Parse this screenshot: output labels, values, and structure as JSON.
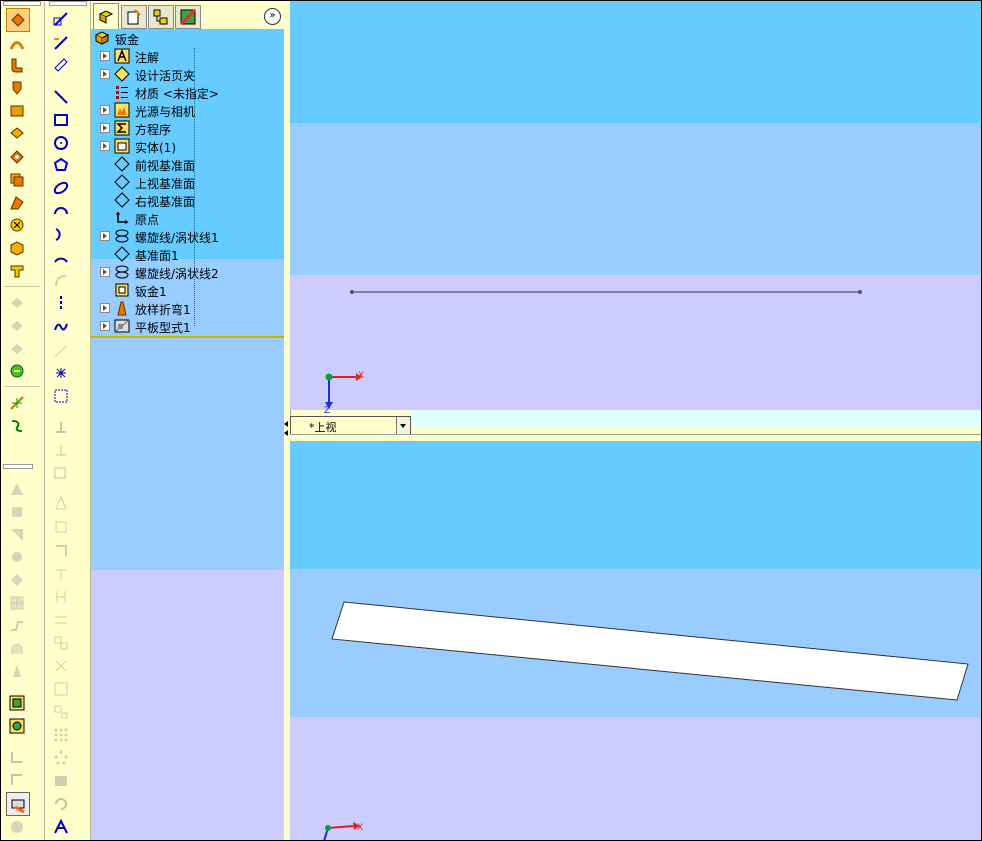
{
  "feature_tree": {
    "root": "钣金",
    "items": [
      {
        "label": "注解",
        "icon": "annotation-icon",
        "expandable": true
      },
      {
        "label": "设计活页夹",
        "icon": "design-binder-icon",
        "expandable": true
      },
      {
        "label": "材质 <未指定>",
        "icon": "material-icon",
        "expandable": false
      },
      {
        "label": "光源与相机",
        "icon": "lights-cameras-icon",
        "expandable": true
      },
      {
        "label": "方程序",
        "icon": "equations-icon",
        "expandable": true
      },
      {
        "label": "实体(1)",
        "icon": "solid-bodies-icon",
        "expandable": true
      },
      {
        "label": "前视基准面",
        "icon": "plane-icon",
        "expandable": false
      },
      {
        "label": "上视基准面",
        "icon": "plane-icon",
        "expandable": false
      },
      {
        "label": "右视基准面",
        "icon": "plane-icon",
        "expandable": false
      },
      {
        "label": "原点",
        "icon": "origin-icon",
        "expandable": false
      },
      {
        "label": "螺旋线/涡状线1",
        "icon": "helix-icon",
        "expandable": true
      },
      {
        "label": "基准面1",
        "icon": "plane-icon",
        "expandable": false
      },
      {
        "label": "螺旋线/涡状线2",
        "icon": "helix-icon",
        "expandable": true
      },
      {
        "label": "钣金1",
        "icon": "sheet-metal-feature-icon",
        "expandable": false
      },
      {
        "label": "放样折弯1",
        "icon": "lofted-bend-icon",
        "expandable": true
      },
      {
        "label": "平板型式1",
        "icon": "flat-pattern-icon",
        "expandable": true
      }
    ],
    "expand_button": "»"
  },
  "viewport": {
    "view_name": "*上视",
    "axis_x": "X",
    "axis_z": "Z"
  },
  "colors": {
    "toolbar_bg": "#ffffcc",
    "band_blue": "#66ccff",
    "band_light": "#99ccff",
    "band_lavender": "#ccccff"
  }
}
